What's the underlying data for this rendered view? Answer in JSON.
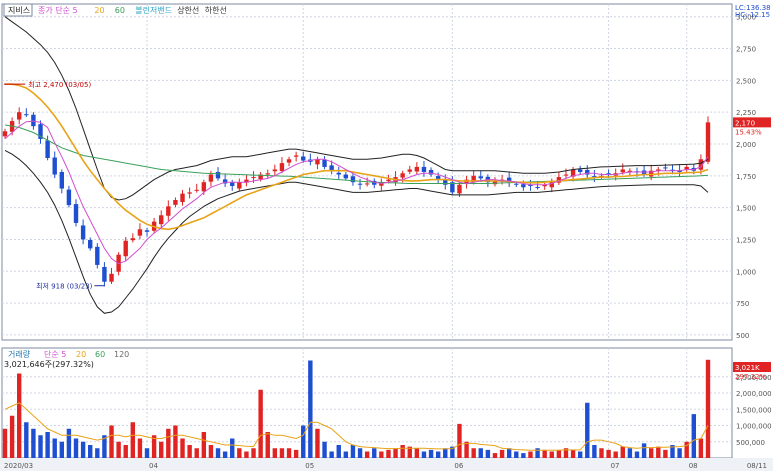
{
  "colors": {
    "up": "#e02424",
    "down": "#1f4fd1",
    "ma5": "#d04fd0",
    "ma20": "#e8a317",
    "ma60": "#3aa05a",
    "ma120": "#6b6b6b",
    "band": "#222222",
    "ref": "#c00000",
    "grid": "#cfd6e3",
    "axis": "#7f8ba0"
  },
  "price_panel": {
    "tag": "지비스",
    "legend": [
      {
        "label": "종가 단순 5",
        "color": "#d04fd0"
      },
      {
        "label": "20",
        "color": "#e8a317"
      },
      {
        "label": "60",
        "color": "#3aa05a"
      },
      {
        "label": "볼린저밴드",
        "color": "#2ca6c6"
      },
      {
        "label": "상한선",
        "color": "#333333"
      },
      {
        "label": "하한선",
        "color": "#333333"
      }
    ],
    "corner_top": "LC:136.38",
    "corner_bottom": "HC:-12.15",
    "current_price": "2,170",
    "current_change": "15.43%",
    "high_note": "최고 2,470 (03/05)",
    "low_note": "최저 918 (03/23)"
  },
  "volume_panel": {
    "tag": "거래량",
    "legend": [
      {
        "label": "단순 5",
        "color": "#d04fd0"
      },
      {
        "label": "20",
        "color": "#e8a317"
      },
      {
        "label": "60",
        "color": "#3aa05a"
      },
      {
        "label": "120",
        "color": "#6b6b6b"
      }
    ],
    "summary": "3,021,646주(297.32%)",
    "current_volume": "3,021K",
    "current_change": "297.32%"
  },
  "x_axis": {
    "labels": [
      "2020/03",
      "04",
      "05",
      "06",
      "07",
      "08"
    ],
    "right_label": "08/11"
  },
  "chart_data": [
    {
      "type": "candlestick",
      "title": "지비스",
      "y_ticks": [
        "3,000",
        "2,750",
        "2,500",
        "2,250",
        "2,000",
        "1,750",
        "1,500",
        "1,250",
        "1,000",
        "750",
        "500"
      ],
      "ylim": [
        460,
        3100
      ],
      "annotations": [
        {
          "text": "최고 2,470 (03/05)",
          "x": "03/05",
          "y": 2470
        },
        {
          "text": "최저 918 (03/23)",
          "x": "03/23",
          "y": 918
        }
      ],
      "close": [
        2100,
        2180,
        2250,
        2230,
        2140,
        2040,
        1890,
        1760,
        1650,
        1520,
        1380,
        1250,
        1180,
        1050,
        918,
        980,
        1130,
        1240,
        1260,
        1330,
        1310,
        1390,
        1440,
        1510,
        1560,
        1610,
        1620,
        1640,
        1700,
        1760,
        1730,
        1690,
        1670,
        1700,
        1720,
        1740,
        1760,
        1770,
        1800,
        1850,
        1880,
        1910,
        1870,
        1860,
        1880,
        1820,
        1790,
        1760,
        1730,
        1700,
        1680,
        1690,
        1680,
        1700,
        1720,
        1740,
        1770,
        1800,
        1820,
        1780,
        1760,
        1720,
        1680,
        1620,
        1680,
        1720,
        1750,
        1730,
        1700,
        1710,
        1720,
        1700,
        1680,
        1660,
        1670,
        1660,
        1680,
        1700,
        1740,
        1760,
        1800,
        1780,
        1760,
        1740,
        1750,
        1760,
        1770,
        1800,
        1790,
        1780,
        1760,
        1790,
        1800,
        1810,
        1790,
        1780,
        1820,
        1790,
        1880,
        2170
      ],
      "ma5": [
        2040,
        2090,
        2140,
        2175,
        2180,
        2170,
        2130,
        2010,
        1900,
        1780,
        1640,
        1510,
        1400,
        1290,
        1180,
        1100,
        1060,
        1080,
        1130,
        1180,
        1250,
        1300,
        1340,
        1390,
        1440,
        1490,
        1530,
        1570,
        1620,
        1660,
        1680,
        1700,
        1700,
        1700,
        1700,
        1710,
        1720,
        1730,
        1750,
        1780,
        1810,
        1840,
        1860,
        1870,
        1880,
        1880,
        1860,
        1830,
        1800,
        1770,
        1740,
        1720,
        1700,
        1690,
        1700,
        1710,
        1720,
        1740,
        1760,
        1770,
        1770,
        1760,
        1740,
        1720,
        1700,
        1690,
        1700,
        1710,
        1720,
        1720,
        1710,
        1710,
        1700,
        1690,
        1680,
        1680,
        1680,
        1690,
        1710,
        1730,
        1750,
        1760,
        1770,
        1770,
        1760,
        1760,
        1760,
        1770,
        1780,
        1780,
        1780,
        1780,
        1790,
        1790,
        1790,
        1790,
        1800,
        1800,
        1820,
        1900
      ],
      "ma20": [
        2470,
        2470,
        2460,
        2440,
        2400,
        2350,
        2290,
        2220,
        2140,
        2050,
        1960,
        1870,
        1790,
        1720,
        1650,
        1590,
        1530,
        1480,
        1440,
        1400,
        1370,
        1350,
        1335,
        1330,
        1340,
        1360,
        1380,
        1400,
        1420,
        1450,
        1480,
        1510,
        1540,
        1570,
        1600,
        1620,
        1640,
        1660,
        1680,
        1700,
        1720,
        1740,
        1760,
        1770,
        1780,
        1790,
        1790,
        1790,
        1790,
        1780,
        1770,
        1760,
        1750,
        1740,
        1730,
        1720,
        1715,
        1710,
        1710,
        1715,
        1720,
        1720,
        1720,
        1715,
        1710,
        1710,
        1710,
        1710,
        1710,
        1710,
        1710,
        1705,
        1700,
        1700,
        1695,
        1695,
        1700,
        1705,
        1710,
        1715,
        1720,
        1725,
        1730,
        1735,
        1740,
        1740,
        1745,
        1745,
        1750,
        1755,
        1760,
        1760,
        1765,
        1770,
        1770,
        1770,
        1775,
        1775,
        1780,
        1800
      ],
      "ma60": [
        2150,
        2140,
        2130,
        2110,
        2090,
        2060,
        2030,
        2000,
        1970,
        1950,
        1930,
        1910,
        1900,
        1890,
        1880,
        1870,
        1860,
        1850,
        1840,
        1830,
        1820,
        1810,
        1800,
        1795,
        1790,
        1785,
        1780,
        1775,
        1770,
        1768,
        1766,
        1764,
        1762,
        1760,
        1758,
        1756,
        1754,
        1752,
        1750,
        1748,
        1746,
        1744,
        1740,
        1736,
        1732,
        1728,
        1724,
        1720,
        1716,
        1712,
        1708,
        1704,
        1700,
        1698,
        1696,
        1694,
        1692,
        1690,
        1690,
        1690,
        1690,
        1690,
        1690,
        1690,
        1690,
        1690,
        1690,
        1690,
        1690,
        1692,
        1694,
        1696,
        1698,
        1700,
        1702,
        1704,
        1706,
        1708,
        1710,
        1712,
        1714,
        1716,
        1718,
        1720,
        1722,
        1724,
        1726,
        1728,
        1730,
        1732,
        1734,
        1736,
        1738,
        1740,
        1742,
        1744,
        1746,
        1748,
        1750,
        1755
      ],
      "upper_band": [
        3000,
        2960,
        2920,
        2880,
        2830,
        2780,
        2720,
        2640,
        2540,
        2420,
        2280,
        2120,
        1960,
        1800,
        1650,
        1580,
        1560,
        1570,
        1600,
        1640,
        1680,
        1720,
        1750,
        1780,
        1800,
        1810,
        1820,
        1830,
        1850,
        1870,
        1880,
        1890,
        1900,
        1900,
        1900,
        1910,
        1920,
        1930,
        1940,
        1950,
        1960,
        1960,
        1950,
        1940,
        1930,
        1920,
        1910,
        1900,
        1890,
        1880,
        1880,
        1880,
        1885,
        1890,
        1900,
        1910,
        1920,
        1920,
        1910,
        1890,
        1860,
        1830,
        1800,
        1790,
        1790,
        1790,
        1790,
        1790,
        1790,
        1790,
        1785,
        1780,
        1775,
        1770,
        1770,
        1770,
        1770,
        1775,
        1780,
        1790,
        1800,
        1805,
        1810,
        1815,
        1820,
        1822,
        1824,
        1826,
        1828,
        1830,
        1830,
        1830,
        1832,
        1834,
        1836,
        1838,
        1840,
        1842,
        1850,
        1880
      ],
      "lower_band": [
        1950,
        1920,
        1880,
        1830,
        1770,
        1700,
        1620,
        1520,
        1400,
        1260,
        1110,
        960,
        820,
        720,
        670,
        680,
        720,
        790,
        860,
        940,
        1020,
        1110,
        1190,
        1260,
        1320,
        1380,
        1430,
        1470,
        1510,
        1540,
        1570,
        1590,
        1610,
        1630,
        1640,
        1650,
        1660,
        1670,
        1680,
        1690,
        1700,
        1700,
        1690,
        1680,
        1670,
        1660,
        1650,
        1640,
        1630,
        1620,
        1620,
        1620,
        1625,
        1630,
        1635,
        1640,
        1645,
        1650,
        1650,
        1640,
        1630,
        1620,
        1610,
        1600,
        1600,
        1600,
        1600,
        1600,
        1600,
        1605,
        1610,
        1615,
        1620,
        1620,
        1620,
        1620,
        1625,
        1630,
        1635,
        1640,
        1645,
        1650,
        1655,
        1660,
        1665,
        1668,
        1670,
        1672,
        1674,
        1676,
        1678,
        1680,
        1680,
        1680,
        1680,
        1680,
        1680,
        1680,
        1670,
        1620
      ]
    },
    {
      "type": "bar",
      "title": "거래량",
      "y_ticks": [
        "2,500,000",
        "2,000,000",
        "1,500,000",
        "1,000,000",
        "500,000"
      ],
      "ylim": [
        0,
        3200000
      ],
      "values": [
        900000,
        1300000,
        2600000,
        1100000,
        900000,
        700000,
        800000,
        600000,
        500000,
        900000,
        600000,
        500000,
        400000,
        300000,
        700000,
        1000000,
        500000,
        400000,
        1100000,
        600000,
        300000,
        700000,
        500000,
        900000,
        1000000,
        600000,
        400000,
        300000,
        800000,
        400000,
        300000,
        200000,
        600000,
        300000,
        200000,
        300000,
        2100000,
        800000,
        300000,
        300000,
        300000,
        250000,
        1000000,
        3000000,
        900000,
        500000,
        200000,
        400000,
        200000,
        400000,
        300000,
        200000,
        300000,
        200000,
        250000,
        300000,
        400000,
        350000,
        300000,
        200000,
        250000,
        200000,
        300000,
        350000,
        1050000,
        500000,
        300000,
        300000,
        250000,
        150000,
        250000,
        300000,
        200000,
        150000,
        200000,
        300000,
        250000,
        200000,
        250000,
        300000,
        250000,
        200000,
        1700000,
        400000,
        300000,
        250000,
        200000,
        350000,
        300000,
        200000,
        450000,
        300000,
        350000,
        250000,
        400000,
        300000,
        500000,
        1350000,
        600000,
        3021646
      ],
      "ma_line": [
        1500000,
        1600000,
        1700000,
        1500000,
        1300000,
        1100000,
        900000,
        800000,
        700000,
        700000,
        700000,
        650000,
        600000,
        550000,
        600000,
        700000,
        700000,
        650000,
        700000,
        700000,
        650000,
        600000,
        600000,
        650000,
        700000,
        700000,
        650000,
        600000,
        550000,
        500000,
        450000,
        400000,
        400000,
        380000,
        360000,
        350000,
        700000,
        750000,
        700000,
        700000,
        650000,
        600000,
        700000,
        1100000,
        1100000,
        1000000,
        900000,
        700000,
        500000,
        400000,
        350000,
        330000,
        320000,
        300000,
        290000,
        290000,
        300000,
        300000,
        300000,
        300000,
        290000,
        280000,
        280000,
        290000,
        420000,
        450000,
        450000,
        420000,
        400000,
        380000,
        300000,
        280000,
        260000,
        250000,
        240000,
        240000,
        240000,
        240000,
        240000,
        250000,
        250000,
        250000,
        500000,
        550000,
        550000,
        500000,
        450000,
        350000,
        320000,
        300000,
        320000,
        320000,
        330000,
        330000,
        340000,
        350000,
        380000,
        550000,
        600000,
        1000000
      ]
    }
  ]
}
